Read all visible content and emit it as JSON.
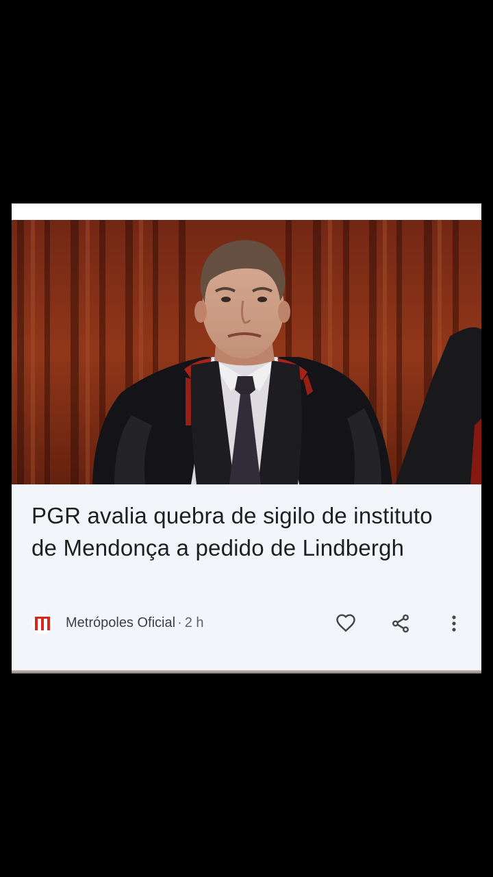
{
  "article": {
    "headline": "PGR avalia quebra de sigilo de instituto de Mendonça a pedido de Lindbergh",
    "source": "Metrópoles Oficial",
    "separator": "·",
    "time_ago": "2 h",
    "image_description": "news-photo"
  },
  "icons": {
    "source_logo": "metropoles-logo",
    "like": "heart-outline-icon",
    "share": "share-icon",
    "more": "more-vert-icon"
  },
  "colors": {
    "background": "#000000",
    "card": "#f3f5fb",
    "headline": "#1f1f1f",
    "meta_text": "#3c4043",
    "logo_red": "#d9261c",
    "icon": "#444746"
  }
}
